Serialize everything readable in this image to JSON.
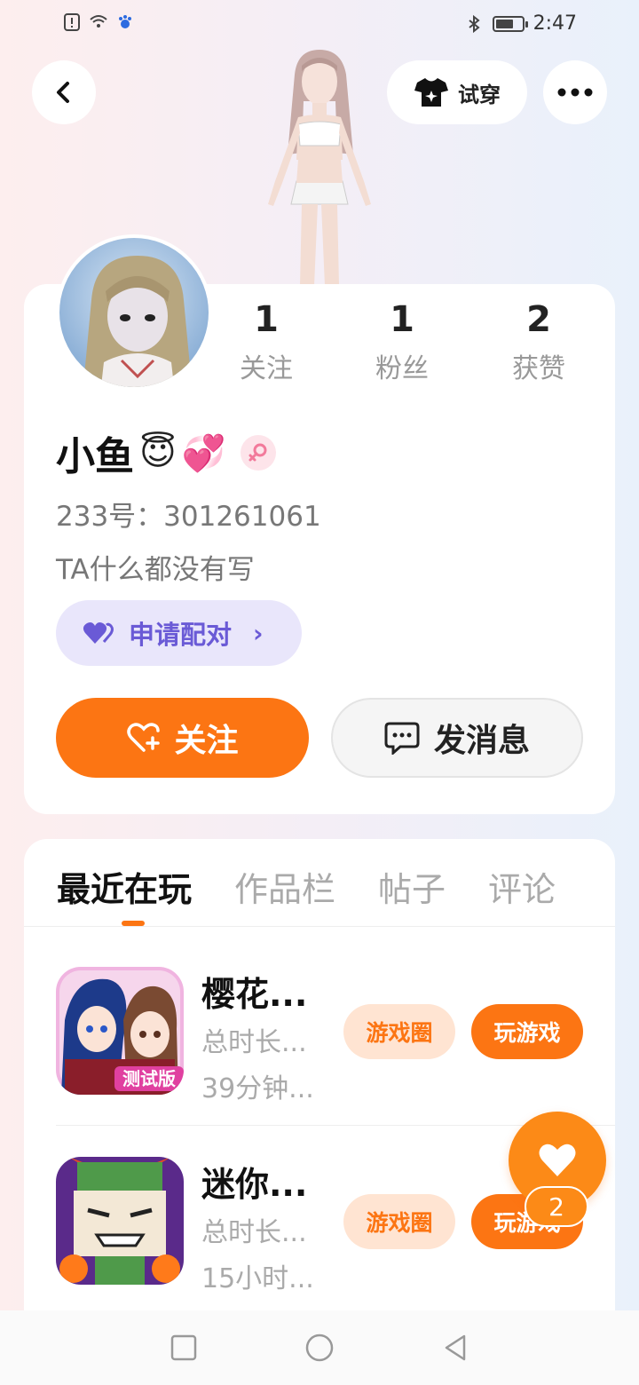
{
  "status_bar": {
    "time": "2:47"
  },
  "header": {
    "tryon_label": "试穿"
  },
  "stats": [
    {
      "value": "1",
      "label": "关注"
    },
    {
      "value": "1",
      "label": "粉丝"
    },
    {
      "value": "2",
      "label": "获赞"
    }
  ],
  "profile": {
    "name": "小鱼",
    "emoji_1": "😇",
    "emoji_2": "💞",
    "uid": "233号：301261061",
    "bio": "TA什么都没有写",
    "pair_label": "申请配对"
  },
  "actions": {
    "follow_label": "关注",
    "message_label": "发消息"
  },
  "tabs": [
    "最近在玩",
    "作品栏",
    "帖子",
    "评论"
  ],
  "games": [
    {
      "name": "樱花...",
      "total": "总时长...",
      "time": "39分钟...",
      "circle_label": "游戏圈",
      "play_label": "玩游戏",
      "badge": "测试版"
    },
    {
      "name": "迷你...",
      "total": "总时长...",
      "time": "15小时...",
      "circle_label": "游戏圈",
      "play_label": "玩游戏"
    }
  ],
  "like_count": "2",
  "colors": {
    "accent": "#fc7513",
    "pair": "#6a5ad6",
    "pair_bg": "#e9e6fb"
  }
}
